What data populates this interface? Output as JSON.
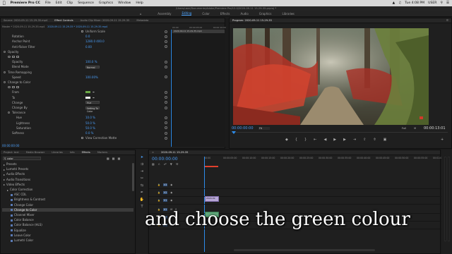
{
  "menubar": {
    "app": "Premiere Pro CC",
    "items": [
      "File",
      "Edit",
      "Clip",
      "Sequence",
      "Graphics",
      "Window",
      "Help"
    ],
    "clock": "Tue 4:08 PM",
    "user": "USER"
  },
  "path": "/Users/user/Documents/Adobe/Premiere Pro/12.0/2020-09-11 15-29-35.prproj *",
  "workspaces": {
    "items": [
      "Assembly",
      "Editing",
      "Color",
      "Effects",
      "Audio",
      "Graphics",
      "Libraries"
    ],
    "active": "Editing"
  },
  "effect_controls": {
    "tabs": [
      "Source: 2020-09-11 15-29-35.mp4",
      "Effect Controls",
      "Audio Clip Mixer: 2020-09-11 15-29-35",
      "Metadata"
    ],
    "active_tab": "Effect Controls",
    "master": "Master * 2020-09-11 15-29-35.mp4",
    "clip": "2020-09-11 15-29-35 * 2020-09-11 15-29-35.mp4",
    "timecode_start": "00:00",
    "timecode_mid": "00:00:05:00",
    "timecode_end": "00:00:10:00",
    "clip_label": "2020-09-11 15-29-35.mp4",
    "rows": [
      {
        "label": "Uniform Scale",
        "value": "",
        "indent": 0,
        "kind": "check"
      },
      {
        "label": "Rotation",
        "value": "0.0",
        "indent": 1
      },
      {
        "label": "Anchor Point",
        "value": "1280.0   400.0",
        "indent": 1
      },
      {
        "label": "Anti-flicker Filter",
        "value": "0.00",
        "indent": 1
      },
      {
        "label": "Opacity",
        "value": "",
        "indent": 0,
        "kind": "group"
      },
      {
        "label": "",
        "value": "",
        "indent": 0,
        "kind": "shapes"
      },
      {
        "label": "Opacity",
        "value": "100.0 %",
        "indent": 1
      },
      {
        "label": "Blend Mode",
        "value": "Normal",
        "indent": 1,
        "kind": "drop"
      },
      {
        "label": "Time Remapping",
        "value": "",
        "indent": 0,
        "kind": "group"
      },
      {
        "label": "Speed",
        "value": "100.00%",
        "indent": 1
      },
      {
        "label": "Change to Color",
        "value": "",
        "indent": 0,
        "kind": "group"
      },
      {
        "label": "",
        "value": "",
        "indent": 0,
        "kind": "shapes"
      },
      {
        "label": "From",
        "value": "",
        "indent": 1,
        "kind": "swatch-green"
      },
      {
        "label": "To",
        "value": "",
        "indent": 1,
        "kind": "swatch-white"
      },
      {
        "label": "Change",
        "value": "Hue",
        "indent": 1,
        "kind": "drop"
      },
      {
        "label": "Change By",
        "value": "Setting To Color",
        "indent": 1,
        "kind": "drop"
      },
      {
        "label": "Tolerance",
        "value": "",
        "indent": 1,
        "kind": "group"
      },
      {
        "label": "Hue",
        "value": "10.0 %",
        "indent": 2
      },
      {
        "label": "Lightness",
        "value": "50.0 %",
        "indent": 2
      },
      {
        "label": "Saturation",
        "value": "50.0 %",
        "indent": 2
      },
      {
        "label": "Softness",
        "value": "0.0 %",
        "indent": 1
      },
      {
        "label": "View Correction Matte",
        "value": "",
        "indent": 1,
        "kind": "check"
      }
    ],
    "current_time": "00:00:00:00"
  },
  "program": {
    "title": "Program: 2020-09-11 15-29-35",
    "timecode": "00:00:00:00",
    "fit": "Fit",
    "quality": "Full",
    "duration": "00:00:13:01"
  },
  "project": {
    "tabs": [
      "Project: text",
      "Media Browser",
      "Libraries",
      "Info",
      "Effects",
      "Markers"
    ],
    "active_tab": "Effects",
    "search": "color",
    "tree": [
      {
        "label": "Presets",
        "level": 0
      },
      {
        "label": "Lumetri Presets",
        "level": 0
      },
      {
        "label": "Audio Effects",
        "level": 0
      },
      {
        "label": "Audio Transitions",
        "level": 0
      },
      {
        "label": "Video Effects",
        "level": 0
      },
      {
        "label": "Color Correction",
        "level": 1
      },
      {
        "label": "ASC CDL",
        "level": 2
      },
      {
        "label": "Brightness & Contrast",
        "level": 2
      },
      {
        "label": "Change Color",
        "level": 2
      },
      {
        "label": "Change to Color",
        "level": 2,
        "selected": true
      },
      {
        "label": "Channel Mixer",
        "level": 2
      },
      {
        "label": "Color Balance",
        "level": 2
      },
      {
        "label": "Color Balance (HLS)",
        "level": 2
      },
      {
        "label": "Equalize",
        "level": 2
      },
      {
        "label": "Leave Color",
        "level": 2
      },
      {
        "label": "Lumetri Color",
        "level": 2
      }
    ]
  },
  "timeline": {
    "title": "2020-09-11 15-29-35",
    "timecode": "00:00:00:00",
    "ruler": [
      "00:00",
      "00:00:05:00",
      "00:00:10:00",
      "00:00:15:00",
      "00:00:20:00",
      "00:00:25:00",
      "00:00:30:00",
      "00:00:35:00",
      "00:00:40:00",
      "00:00:45:00",
      "00:00:50:00",
      "00:00:55:00",
      "00:01:00:00"
    ],
    "tracks": [
      "V3",
      "V2",
      "V1",
      "A1",
      "A2",
      "A3"
    ],
    "clip_label": "2020-09"
  },
  "caption": "and choose the green colour",
  "colors": {
    "accent": "#4aa3ff",
    "playhead": "#2d8ceb",
    "inpoint": "#e0402c"
  }
}
